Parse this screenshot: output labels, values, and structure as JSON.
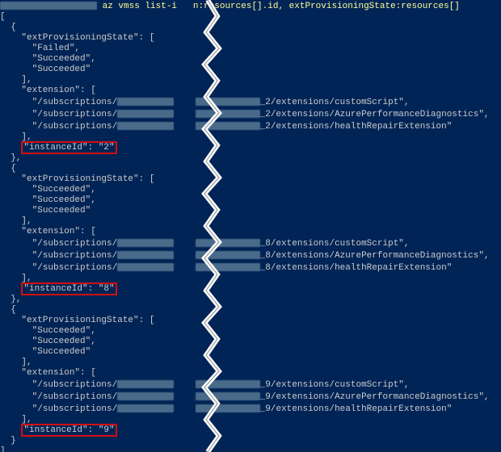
{
  "command": "az vmss list-i",
  "command_cont": "n:resources[].id, extProvisioningState:resources[]",
  "instances": [
    {
      "provisioning": [
        "Failed",
        "Succeeded",
        "Succeeded"
      ],
      "suffix": "_2",
      "extensions": [
        "customScript",
        "AzurePerformanceDiagnostics",
        "healthRepairExtension"
      ],
      "instance_id_label": "\"instanceId\": \"2\""
    },
    {
      "provisioning": [
        "Succeeded",
        "Succeeded",
        "Succeeded"
      ],
      "suffix": "_8",
      "extensions": [
        "customScript",
        "AzurePerformanceDiagnostics",
        "healthRepairExtension"
      ],
      "instance_id_label": "\"instanceId\": \"8\""
    },
    {
      "provisioning": [
        "Succeeded",
        "Succeeded",
        "Succeeded"
      ],
      "suffix": "_9",
      "extensions": [
        "customScript",
        "AzurePerformanceDiagnostics",
        "healthRepairExtension"
      ],
      "instance_id_label": "\"instanceId\": \"9\""
    }
  ],
  "labels": {
    "extProvisioningState": "\"extProvisioningState\": [",
    "extension": "\"extension\": [",
    "subscriptions": "/subscriptions/",
    "extensions_path": "/extensions/"
  }
}
